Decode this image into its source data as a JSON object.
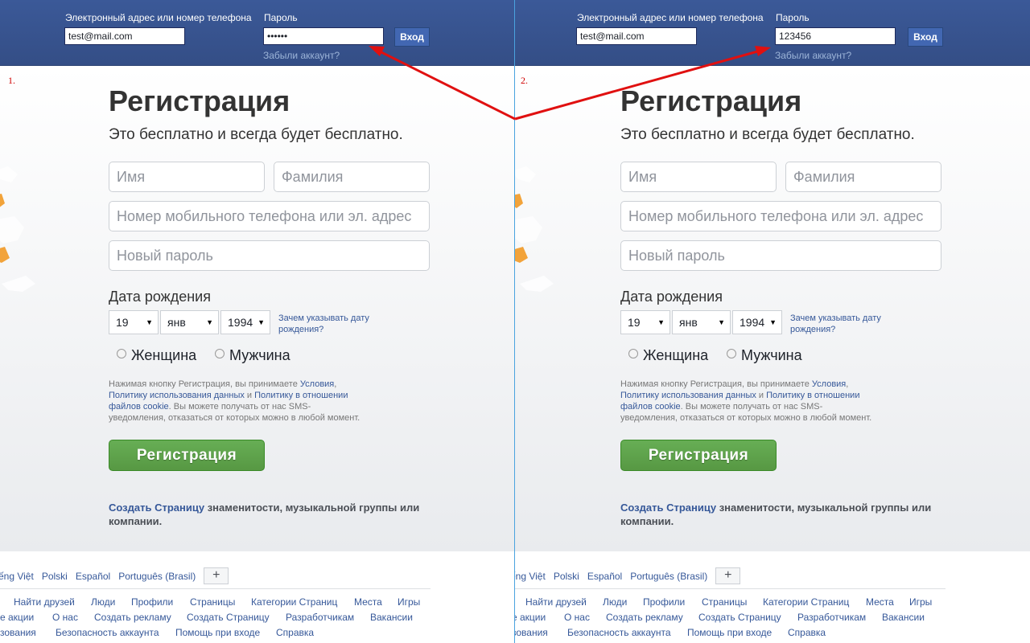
{
  "panels": [
    {
      "step": "1.",
      "email_label": "Электронный адрес или номер телефона",
      "password_label": "Пароль",
      "email_value": "test@mail.com",
      "password_value": "••••••",
      "login_label": "Вход",
      "forgot_label": "Забыли аккаунт?"
    },
    {
      "step": "2.",
      "email_label": "Электронный адрес или номер телефона",
      "password_label": "Пароль",
      "email_value": "test@mail.com",
      "password_value": "123456",
      "login_label": "Вход",
      "forgot_label": "Забыли аккаунт?"
    }
  ],
  "signup": {
    "title": "Регистрация",
    "subtitle": "Это бесплатно и всегда будет бесплатно.",
    "first_name_placeholder": "Имя",
    "last_name_placeholder": "Фамилия",
    "contact_placeholder": "Номер мобильного телефона или эл. адрес",
    "password_placeholder": "Новый пароль",
    "dob_label": "Дата рождения",
    "dob_day": "19",
    "dob_month": "янв",
    "dob_year": "1994",
    "dob_why": "Зачем указывать дату рождения?",
    "gender_female": "Женщина",
    "gender_male": "Мужчина",
    "terms_1": "Нажимая кнопку Регистрация, вы принимаете ",
    "terms_link_1": "Условия",
    "terms_2": ",",
    "terms_link_2": "Политику использования данных",
    "terms_3": " и ",
    "terms_link_3": "Политику в отношении файлов cookie",
    "terms_4": ". Вы можете получать от нас SMS-уведомления, отказаться от которых можно в любой момент.",
    "register_button": "Регистрация",
    "create_page_link": "Создать Страницу",
    "create_page_text": " знаменитости, музыкальной группы или компании."
  },
  "footer": {
    "languages": [
      "ếng Việt",
      "Polski",
      "Español",
      "Português (Brasil)"
    ],
    "more_languages": "+",
    "row1": [
      "Найти друзей",
      "Люди",
      "Профили",
      "Страницы",
      "Категории Страниц",
      "Места",
      "Игры"
    ],
    "row2": [
      "е акции",
      "О нас",
      "Создать рекламу",
      "Создать Страницу",
      "Разработчикам",
      "Вакансии"
    ],
    "row3": [
      "зования",
      "Безопасность аккаунта",
      "Помощь при входе",
      "Справка"
    ]
  },
  "colors": {
    "brand_blue": "#3b5998",
    "link_blue": "#365899",
    "register_green": "#5fa54b",
    "annotation_red": "#e01010"
  }
}
